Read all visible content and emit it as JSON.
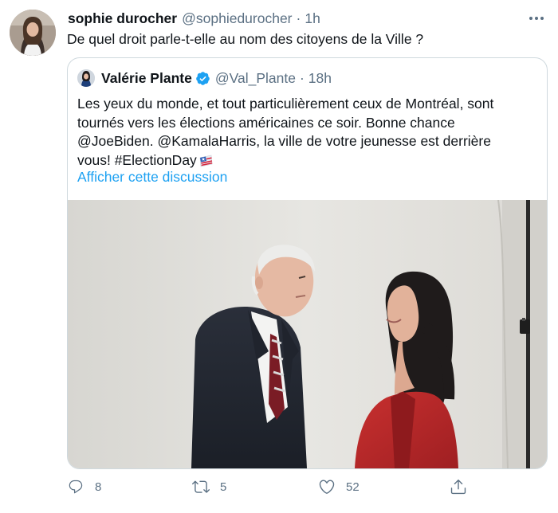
{
  "tweet": {
    "author_name": "sophie durocher",
    "author_handle": "@sophiedurocher",
    "separator": "·",
    "time": "1h",
    "text": "De quel droit parle-t-elle au nom des citoyens de la Ville ?"
  },
  "quoted": {
    "author_name": "Valérie Plante",
    "author_handle": "@Val_Plante",
    "separator": "·",
    "time": "18h",
    "text_lines": [
      "Les yeux du monde, et tout particulièrement ceux de Montréal, sont",
      "tournés vers les élections américaines ce soir. Bonne chance",
      "@JoeBiden. @KamalaHarris, la ville de votre jeunesse est derrière",
      "vous! #ElectionDay"
    ],
    "show_thread": "Afficher cette discussion",
    "verified": true
  },
  "actions": {
    "replies": "8",
    "retweets": "5",
    "likes": "52"
  },
  "colors": {
    "text": "#0f1419",
    "secondary": "#5b7083",
    "link": "#1da1f2",
    "border": "#cfd9de"
  },
  "icons": {
    "more": "ellipsis-icon",
    "verified": "verified-badge-icon",
    "reply": "reply-icon",
    "retweet": "retweet-icon",
    "like": "heart-icon",
    "share": "share-icon"
  }
}
